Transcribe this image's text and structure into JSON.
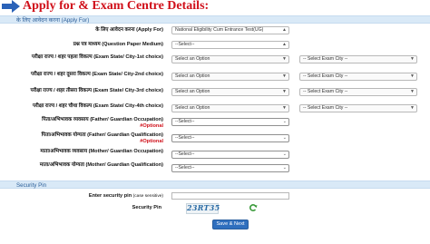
{
  "banner": {
    "title": "Apply for & Exam Centre Details:"
  },
  "section1": {
    "header": "के लिए आवेदन करना (Apply For)"
  },
  "fields": {
    "apply_for": {
      "label": "के लिए आवेदन करना (Apply For)",
      "value": "National Eligibility Cum Entrance Test(UG)"
    },
    "paper_medium": {
      "label": "प्रश्न पत्र माध्यम (Question Paper Medium)",
      "value": "--Select--"
    },
    "city1": {
      "label": "परीक्षा राज्य / शहर पहला विकल्प (Exam State/ City-1st choice)",
      "state_placeholder": "Select an Option",
      "city_placeholder": "-- Select Exam City --"
    },
    "city2": {
      "label": "परीक्षा राज्य / शहर दूसरा विकल्प (Exam State/ City-2nd choice)",
      "state_placeholder": "Select an Option",
      "city_placeholder": "-- Select Exam City --"
    },
    "city3": {
      "label": "परीक्षा राज्य / शहर तीसरा विकल्प (Exam State/ City-3rd choice)",
      "state_placeholder": "Select an Option",
      "city_placeholder": "-- Select Exam City --"
    },
    "city4": {
      "label": "परीक्षा राज्य / शहर चौथा विकल्प (Exam State/ City-4th choice)",
      "state_placeholder": "Select an Option",
      "city_placeholder": "-- Select Exam City --"
    },
    "father_occupation": {
      "label": "पिता/अभिभावक व्यवसाय (Father/ Guardian Occupation)",
      "optional": "#Optional",
      "value": "--Select--"
    },
    "father_qualification": {
      "label": "पिता/अभिभावक योग्यता (Father/ Guardian Qualification)",
      "optional": "#Optional",
      "value": "--Select--"
    },
    "mother_occupation": {
      "label": "माता/अभिभावक व्यवसाय (Mother/ Guardian Occupation)",
      "value": "--Select--"
    },
    "mother_qualification": {
      "label": "माता/अभिभावक योग्यता (Mother/ Guardian Qualification)",
      "value": "--Select--"
    }
  },
  "security": {
    "header": "Security Pin",
    "enter_label": "Enter security pin",
    "enter_note": "(case sensitive)",
    "pin_label": "Security Pin",
    "pin_value": "23RT35",
    "submit_label": "Save & Next"
  },
  "colors": {
    "banner": "#d0101a",
    "header_bg": "#d9e9f7",
    "header_text": "#2a5d97",
    "button": "#2f6fbe"
  }
}
